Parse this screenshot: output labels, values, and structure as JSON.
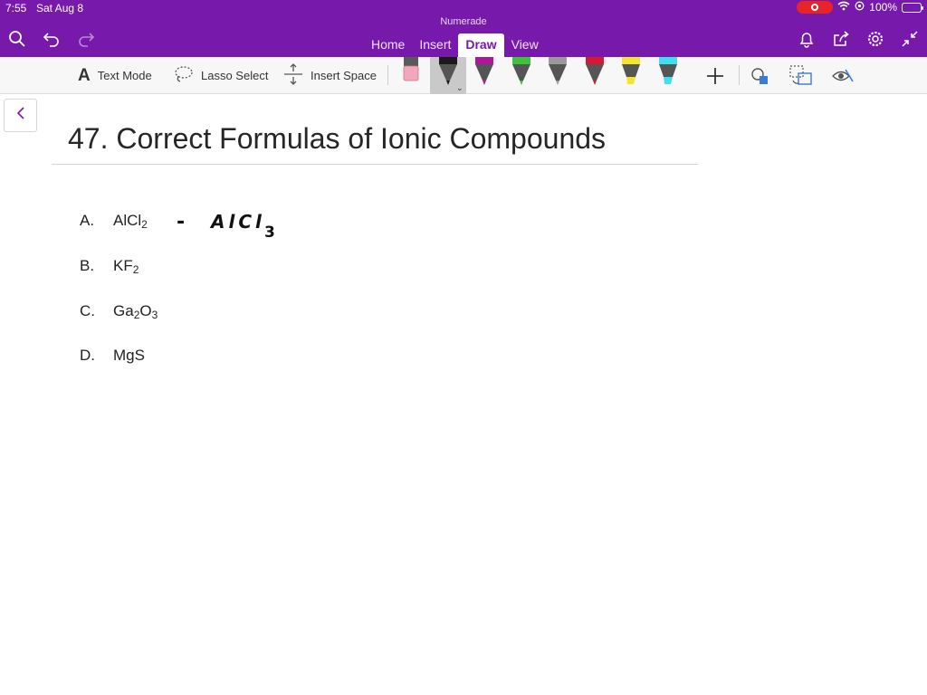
{
  "status": {
    "time": "7:55",
    "date": "Sat Aug 8",
    "battery": "100%",
    "battery_level": 1.0
  },
  "app": {
    "title": "Numerade"
  },
  "nav": {
    "icons": [
      "search-icon",
      "undo-icon",
      "redo-icon"
    ],
    "tabs": [
      {
        "label": "Home"
      },
      {
        "label": "Insert"
      },
      {
        "label": "Draw"
      },
      {
        "label": "View"
      }
    ],
    "active_tab": "Draw",
    "right_icons": [
      "bell-icon",
      "share-icon",
      "gear-icon",
      "collapse-icon"
    ]
  },
  "toolbar": {
    "text_mode": "Text Mode",
    "lasso_select": "Lasso Select",
    "insert_space": "Insert Space",
    "pens": [
      {
        "kind": "eraser",
        "color": "#f2a7bf"
      },
      {
        "kind": "pen",
        "color": "#1a1a1a",
        "selected": true
      },
      {
        "kind": "pen",
        "color": "#b0169b"
      },
      {
        "kind": "pen",
        "color": "#3cc43a"
      },
      {
        "kind": "pen",
        "color": "#9a9a9a"
      },
      {
        "kind": "pen",
        "color": "#d8182e"
      },
      {
        "kind": "highlighter",
        "color": "#f5e52a"
      },
      {
        "kind": "highlighter",
        "color": "#3ee0f0"
      }
    ],
    "extra_icons": [
      "add-icon",
      "shapes-icon",
      "ink-to-shape-icon",
      "ink-replay-icon"
    ]
  },
  "page": {
    "title": "47. Correct Formulas of Ionic Compounds",
    "items": [
      {
        "letter": "A.",
        "base": "AlCl",
        "sub": "2",
        "rest": ""
      },
      {
        "letter": "B.",
        "base": "KF",
        "sub": "2",
        "rest": ""
      },
      {
        "letter": "C.",
        "base": "Ga",
        "sub": "2",
        "rest": "O",
        "sub2": "3"
      },
      {
        "letter": "D.",
        "base": "MgS",
        "sub": "",
        "rest": ""
      }
    ],
    "handwriting": {
      "dash": "-",
      "formula": "AlCl",
      "subscript": "3"
    }
  },
  "colors": {
    "accent": "#7719aa",
    "toolbar_bg": "#f7f7f7"
  }
}
